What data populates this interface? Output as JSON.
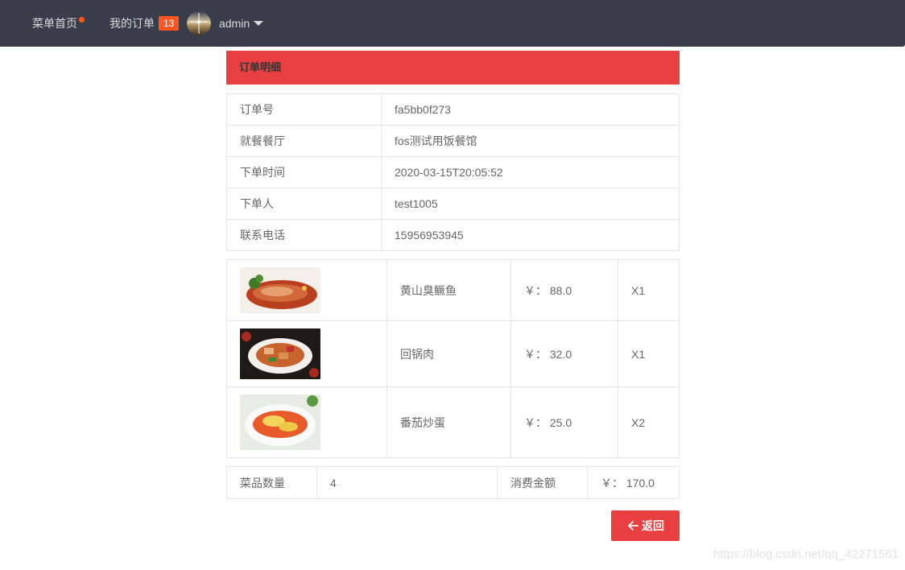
{
  "nav": {
    "menu_home": "菜单首页",
    "my_orders": "我的订单",
    "orders_count": "13",
    "username": "admin"
  },
  "order": {
    "header": "订单明细",
    "fields": [
      {
        "label": "订单号",
        "value": "fa5bb0f273"
      },
      {
        "label": "就餐餐厅",
        "value": "fos测试用饭餐馆"
      },
      {
        "label": "下单时间",
        "value": "2020-03-15T20:05:52"
      },
      {
        "label": "下单人",
        "value": "test1005"
      },
      {
        "label": "联系电话",
        "value": "15956953945"
      }
    ],
    "items": [
      {
        "name": "黄山臭鳜鱼",
        "price": "￥： 88.0",
        "qty": "X1"
      },
      {
        "name": "回锅肉",
        "price": "￥： 32.0",
        "qty": "X1"
      },
      {
        "name": "番茄炒蛋",
        "price": "￥： 25.0",
        "qty": "X2"
      }
    ],
    "summary": {
      "count_label": "菜品数量",
      "count_value": "4",
      "amount_label": "消费金额",
      "amount_value": "￥： 170.0"
    },
    "back_label": "返回"
  },
  "watermark": "https://blog.csdn.net/qq_42271561",
  "colors": {
    "topbar": "#393d49",
    "accent": "#e84040",
    "badge": "#ff5722"
  }
}
